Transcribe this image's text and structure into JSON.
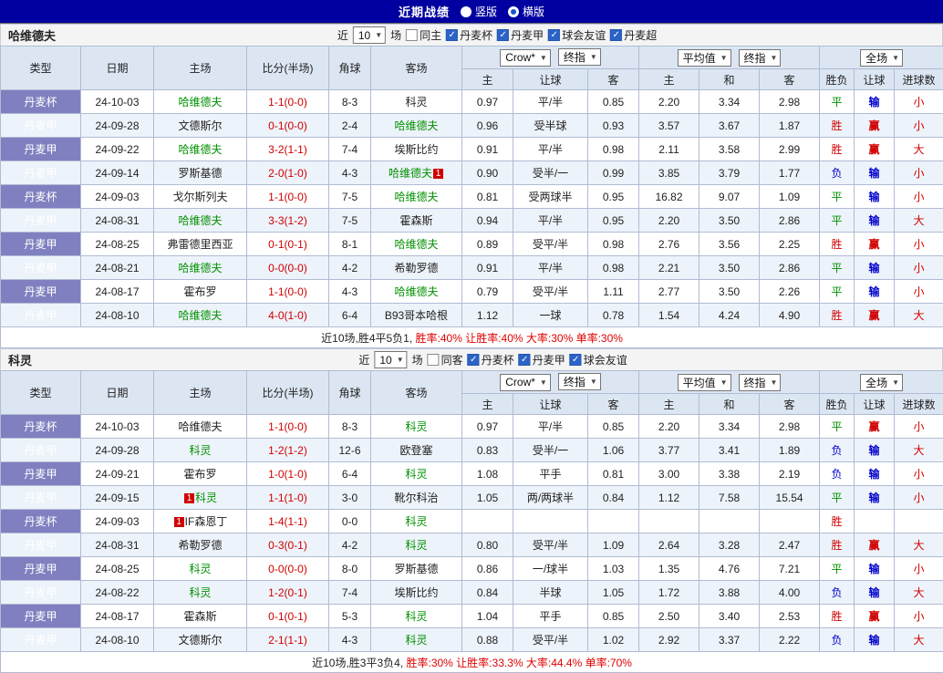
{
  "topbar": {
    "title": "近期战绩",
    "radios": [
      {
        "label": "竖版",
        "checked": false
      },
      {
        "label": "横版",
        "checked": true
      }
    ]
  },
  "table_headers": {
    "cols": [
      "类型",
      "日期",
      "主场",
      "比分(半场)",
      "角球",
      "客场"
    ],
    "sub": [
      "主",
      "让球",
      "客",
      "主",
      "和",
      "客",
      "胜负",
      "让球",
      "进球数"
    ],
    "odds_group1": [
      "Crow*",
      "终指"
    ],
    "odds_group2": [
      "平均值",
      "终指"
    ],
    "odds_group3": [
      "全场"
    ]
  },
  "sections": [
    {
      "team": "哈维德夫",
      "filter": {
        "prefix": "近",
        "count": "10",
        "suffix": "场",
        "checkboxes": [
          {
            "label": "同主",
            "checked": false
          },
          {
            "label": "丹麦杯",
            "checked": true
          },
          {
            "label": "丹麦甲",
            "checked": true
          },
          {
            "label": "球会友谊",
            "checked": true
          },
          {
            "label": "丹麦超",
            "checked": true
          }
        ]
      },
      "rows": [
        {
          "league": "丹麦杯",
          "date": "24-10-03",
          "home": "哈维德夫",
          "home_focus": true,
          "score": "1-1(0-0)",
          "corner": "8-3",
          "away": "科灵",
          "odds": [
            "0.97",
            "平/半",
            "0.85",
            "2.20",
            "3.34",
            "2.98"
          ],
          "result": "平",
          "handicap": "输",
          "goals": "小"
        },
        {
          "league": "丹麦甲",
          "date": "24-09-28",
          "home": "文德斯尔",
          "score": "0-1(0-0)",
          "corner": "2-4",
          "away": "哈维德夫",
          "away_focus": true,
          "odds": [
            "0.96",
            "受半球",
            "0.93",
            "3.57",
            "3.67",
            "1.87"
          ],
          "result": "胜",
          "handicap": "赢",
          "goals": "小"
        },
        {
          "league": "丹麦甲",
          "date": "24-09-22",
          "home": "哈维德夫",
          "home_focus": true,
          "score": "3-2(1-1)",
          "corner": "7-4",
          "away": "埃斯比约",
          "odds": [
            "0.91",
            "平/半",
            "0.98",
            "2.11",
            "3.58",
            "2.99"
          ],
          "result": "胜",
          "handicap": "赢",
          "goals": "大"
        },
        {
          "league": "丹麦甲",
          "date": "24-09-14",
          "home": "罗斯基德",
          "score": "2-0(1-0)",
          "corner": "4-3",
          "away": "哈维德夫",
          "away_focus": true,
          "away_badge_post": "1",
          "odds": [
            "0.90",
            "受半/一",
            "0.99",
            "3.85",
            "3.79",
            "1.77"
          ],
          "result": "负",
          "handicap": "输",
          "goals": "小"
        },
        {
          "league": "丹麦杯",
          "date": "24-09-03",
          "home": "戈尔斯列夫",
          "score": "1-1(0-0)",
          "corner": "7-5",
          "away": "哈维德夫",
          "away_focus": true,
          "odds": [
            "0.81",
            "受两球半",
            "0.95",
            "16.82",
            "9.07",
            "1.09"
          ],
          "result": "平",
          "handicap": "输",
          "goals": "小"
        },
        {
          "league": "丹麦甲",
          "date": "24-08-31",
          "home": "哈维德夫",
          "home_focus": true,
          "score": "3-3(1-2)",
          "corner": "7-5",
          "away": "霍森斯",
          "odds": [
            "0.94",
            "平/半",
            "0.95",
            "2.20",
            "3.50",
            "2.86"
          ],
          "result": "平",
          "handicap": "输",
          "goals": "大"
        },
        {
          "league": "丹麦甲",
          "date": "24-08-25",
          "home": "弗雷德里西亚",
          "score": "0-1(0-1)",
          "corner": "8-1",
          "away": "哈维德夫",
          "away_focus": true,
          "odds": [
            "0.89",
            "受平/半",
            "0.98",
            "2.76",
            "3.56",
            "2.25"
          ],
          "result": "胜",
          "handicap": "赢",
          "goals": "小"
        },
        {
          "league": "丹麦甲",
          "date": "24-08-21",
          "home": "哈维德夫",
          "home_focus": true,
          "score": "0-0(0-0)",
          "corner": "4-2",
          "away": "希勒罗德",
          "odds": [
            "0.91",
            "平/半",
            "0.98",
            "2.21",
            "3.50",
            "2.86"
          ],
          "result": "平",
          "handicap": "输",
          "goals": "小"
        },
        {
          "league": "丹麦甲",
          "date": "24-08-17",
          "home": "霍布罗",
          "score": "1-1(0-0)",
          "corner": "4-3",
          "away": "哈维德夫",
          "away_focus": true,
          "odds": [
            "0.79",
            "受平/半",
            "1.11",
            "2.77",
            "3.50",
            "2.26"
          ],
          "result": "平",
          "handicap": "输",
          "goals": "小"
        },
        {
          "league": "丹麦甲",
          "date": "24-08-10",
          "home": "哈维德夫",
          "home_focus": true,
          "score": "4-0(1-0)",
          "corner": "6-4",
          "away": "B93哥本哈根",
          "odds": [
            "1.12",
            "一球",
            "0.78",
            "1.54",
            "4.24",
            "4.90"
          ],
          "result": "胜",
          "handicap": "赢",
          "goals": "大"
        }
      ],
      "summary": {
        "prefix": "近10场,胜4平5负1,",
        "stats": "胜率:40% 让胜率:40% 大率:30% 单率:30%"
      }
    },
    {
      "team": "科灵",
      "filter": {
        "prefix": "近",
        "count": "10",
        "suffix": "场",
        "checkboxes": [
          {
            "label": "同客",
            "checked": false
          },
          {
            "label": "丹麦杯",
            "checked": true
          },
          {
            "label": "丹麦甲",
            "checked": true
          },
          {
            "label": "球会友谊",
            "checked": true
          }
        ]
      },
      "rows": [
        {
          "league": "丹麦杯",
          "date": "24-10-03",
          "home": "哈维德夫",
          "score": "1-1(0-0)",
          "corner": "8-3",
          "away": "科灵",
          "away_focus": true,
          "odds": [
            "0.97",
            "平/半",
            "0.85",
            "2.20",
            "3.34",
            "2.98"
          ],
          "result": "平",
          "handicap": "赢",
          "goals": "小"
        },
        {
          "league": "丹麦甲",
          "date": "24-09-28",
          "home": "科灵",
          "home_focus": true,
          "score": "1-2(1-2)",
          "corner": "12-6",
          "away": "欧登塞",
          "odds": [
            "0.83",
            "受半/一",
            "1.06",
            "3.77",
            "3.41",
            "1.89"
          ],
          "result": "负",
          "handicap": "输",
          "goals": "大"
        },
        {
          "league": "丹麦甲",
          "date": "24-09-21",
          "home": "霍布罗",
          "score": "1-0(1-0)",
          "corner": "6-4",
          "away": "科灵",
          "away_focus": true,
          "odds": [
            "1.08",
            "平手",
            "0.81",
            "3.00",
            "3.38",
            "2.19"
          ],
          "result": "负",
          "handicap": "输",
          "goals": "小"
        },
        {
          "league": "丹麦甲",
          "date": "24-09-15",
          "home": "科灵",
          "home_focus": true,
          "home_badge_pre": "1",
          "score": "1-1(1-0)",
          "corner": "3-0",
          "away": "靴尔科治",
          "odds": [
            "1.05",
            "两/两球半",
            "0.84",
            "1.12",
            "7.58",
            "15.54"
          ],
          "result": "平",
          "handicap": "输",
          "goals": "小"
        },
        {
          "league": "丹麦杯",
          "date": "24-09-03",
          "home": "IF森恩丁",
          "home_badge_pre": "1",
          "score": "1-4(1-1)",
          "corner": "0-0",
          "away": "科灵",
          "away_focus": true,
          "odds": [
            "",
            "",
            "",
            "",
            "",
            ""
          ],
          "result": "胜",
          "handicap": "",
          "goals": ""
        },
        {
          "league": "丹麦甲",
          "date": "24-08-31",
          "home": "希勒罗德",
          "score": "0-3(0-1)",
          "corner": "4-2",
          "away": "科灵",
          "away_focus": true,
          "odds": [
            "0.80",
            "受平/半",
            "1.09",
            "2.64",
            "3.28",
            "2.47"
          ],
          "result": "胜",
          "handicap": "赢",
          "goals": "大"
        },
        {
          "league": "丹麦甲",
          "date": "24-08-25",
          "home": "科灵",
          "home_focus": true,
          "score": "0-0(0-0)",
          "corner": "8-0",
          "away": "罗斯基德",
          "odds": [
            "0.86",
            "一/球半",
            "1.03",
            "1.35",
            "4.76",
            "7.21"
          ],
          "result": "平",
          "handicap": "输",
          "goals": "小"
        },
        {
          "league": "丹麦甲",
          "date": "24-08-22",
          "home": "科灵",
          "home_focus": true,
          "score": "1-2(0-1)",
          "corner": "7-4",
          "away": "埃斯比约",
          "odds": [
            "0.84",
            "半球",
            "1.05",
            "1.72",
            "3.88",
            "4.00"
          ],
          "result": "负",
          "handicap": "输",
          "goals": "大"
        },
        {
          "league": "丹麦甲",
          "date": "24-08-17",
          "home": "霍森斯",
          "score": "0-1(0-1)",
          "corner": "5-3",
          "away": "科灵",
          "away_focus": true,
          "odds": [
            "1.04",
            "平手",
            "0.85",
            "2.50",
            "3.40",
            "2.53"
          ],
          "result": "胜",
          "handicap": "赢",
          "goals": "小"
        },
        {
          "league": "丹麦甲",
          "date": "24-08-10",
          "home": "文德斯尔",
          "score": "2-1(1-1)",
          "corner": "4-3",
          "away": "科灵",
          "away_focus": true,
          "odds": [
            "0.88",
            "受平/半",
            "1.02",
            "2.92",
            "3.37",
            "2.22"
          ],
          "result": "负",
          "handicap": "输",
          "goals": "大"
        }
      ],
      "summary": {
        "prefix": "近10场,胜3平3负4,",
        "stats": "胜率:30% 让胜率:33.3% 大率:44.4% 单率:70%"
      }
    }
  ]
}
